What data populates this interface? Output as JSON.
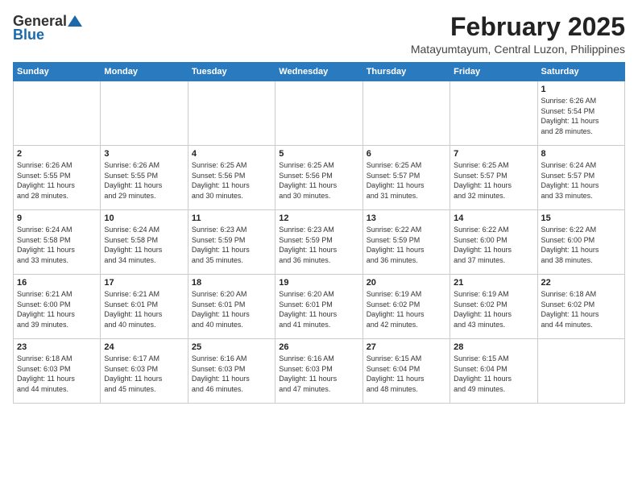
{
  "header": {
    "logo_general": "General",
    "logo_blue": "Blue",
    "month_title": "February 2025",
    "location": "Matayumtayum, Central Luzon, Philippines"
  },
  "weekdays": [
    "Sunday",
    "Monday",
    "Tuesday",
    "Wednesday",
    "Thursday",
    "Friday",
    "Saturday"
  ],
  "weeks": [
    [
      {
        "day": "",
        "info": ""
      },
      {
        "day": "",
        "info": ""
      },
      {
        "day": "",
        "info": ""
      },
      {
        "day": "",
        "info": ""
      },
      {
        "day": "",
        "info": ""
      },
      {
        "day": "",
        "info": ""
      },
      {
        "day": "1",
        "info": "Sunrise: 6:26 AM\nSunset: 5:54 PM\nDaylight: 11 hours\nand 28 minutes."
      }
    ],
    [
      {
        "day": "2",
        "info": "Sunrise: 6:26 AM\nSunset: 5:55 PM\nDaylight: 11 hours\nand 28 minutes."
      },
      {
        "day": "3",
        "info": "Sunrise: 6:26 AM\nSunset: 5:55 PM\nDaylight: 11 hours\nand 29 minutes."
      },
      {
        "day": "4",
        "info": "Sunrise: 6:25 AM\nSunset: 5:56 PM\nDaylight: 11 hours\nand 30 minutes."
      },
      {
        "day": "5",
        "info": "Sunrise: 6:25 AM\nSunset: 5:56 PM\nDaylight: 11 hours\nand 30 minutes."
      },
      {
        "day": "6",
        "info": "Sunrise: 6:25 AM\nSunset: 5:57 PM\nDaylight: 11 hours\nand 31 minutes."
      },
      {
        "day": "7",
        "info": "Sunrise: 6:25 AM\nSunset: 5:57 PM\nDaylight: 11 hours\nand 32 minutes."
      },
      {
        "day": "8",
        "info": "Sunrise: 6:24 AM\nSunset: 5:57 PM\nDaylight: 11 hours\nand 33 minutes."
      }
    ],
    [
      {
        "day": "9",
        "info": "Sunrise: 6:24 AM\nSunset: 5:58 PM\nDaylight: 11 hours\nand 33 minutes."
      },
      {
        "day": "10",
        "info": "Sunrise: 6:24 AM\nSunset: 5:58 PM\nDaylight: 11 hours\nand 34 minutes."
      },
      {
        "day": "11",
        "info": "Sunrise: 6:23 AM\nSunset: 5:59 PM\nDaylight: 11 hours\nand 35 minutes."
      },
      {
        "day": "12",
        "info": "Sunrise: 6:23 AM\nSunset: 5:59 PM\nDaylight: 11 hours\nand 36 minutes."
      },
      {
        "day": "13",
        "info": "Sunrise: 6:22 AM\nSunset: 5:59 PM\nDaylight: 11 hours\nand 36 minutes."
      },
      {
        "day": "14",
        "info": "Sunrise: 6:22 AM\nSunset: 6:00 PM\nDaylight: 11 hours\nand 37 minutes."
      },
      {
        "day": "15",
        "info": "Sunrise: 6:22 AM\nSunset: 6:00 PM\nDaylight: 11 hours\nand 38 minutes."
      }
    ],
    [
      {
        "day": "16",
        "info": "Sunrise: 6:21 AM\nSunset: 6:00 PM\nDaylight: 11 hours\nand 39 minutes."
      },
      {
        "day": "17",
        "info": "Sunrise: 6:21 AM\nSunset: 6:01 PM\nDaylight: 11 hours\nand 40 minutes."
      },
      {
        "day": "18",
        "info": "Sunrise: 6:20 AM\nSunset: 6:01 PM\nDaylight: 11 hours\nand 40 minutes."
      },
      {
        "day": "19",
        "info": "Sunrise: 6:20 AM\nSunset: 6:01 PM\nDaylight: 11 hours\nand 41 minutes."
      },
      {
        "day": "20",
        "info": "Sunrise: 6:19 AM\nSunset: 6:02 PM\nDaylight: 11 hours\nand 42 minutes."
      },
      {
        "day": "21",
        "info": "Sunrise: 6:19 AM\nSunset: 6:02 PM\nDaylight: 11 hours\nand 43 minutes."
      },
      {
        "day": "22",
        "info": "Sunrise: 6:18 AM\nSunset: 6:02 PM\nDaylight: 11 hours\nand 44 minutes."
      }
    ],
    [
      {
        "day": "23",
        "info": "Sunrise: 6:18 AM\nSunset: 6:03 PM\nDaylight: 11 hours\nand 44 minutes."
      },
      {
        "day": "24",
        "info": "Sunrise: 6:17 AM\nSunset: 6:03 PM\nDaylight: 11 hours\nand 45 minutes."
      },
      {
        "day": "25",
        "info": "Sunrise: 6:16 AM\nSunset: 6:03 PM\nDaylight: 11 hours\nand 46 minutes."
      },
      {
        "day": "26",
        "info": "Sunrise: 6:16 AM\nSunset: 6:03 PM\nDaylight: 11 hours\nand 47 minutes."
      },
      {
        "day": "27",
        "info": "Sunrise: 6:15 AM\nSunset: 6:04 PM\nDaylight: 11 hours\nand 48 minutes."
      },
      {
        "day": "28",
        "info": "Sunrise: 6:15 AM\nSunset: 6:04 PM\nDaylight: 11 hours\nand 49 minutes."
      },
      {
        "day": "",
        "info": ""
      }
    ]
  ]
}
